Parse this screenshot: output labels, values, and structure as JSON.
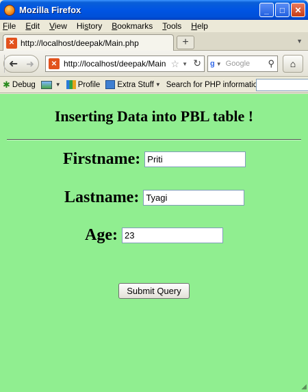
{
  "window": {
    "title": "Mozilla Firefox",
    "buttons": {
      "minimize": "_",
      "maximize": "□",
      "close": "✕"
    }
  },
  "menu": [
    {
      "label": "File",
      "accel": "F"
    },
    {
      "label": "Edit",
      "accel": "E"
    },
    {
      "label": "View",
      "accel": "V"
    },
    {
      "label": "History",
      "accel": "s"
    },
    {
      "label": "Bookmarks",
      "accel": "B"
    },
    {
      "label": "Tools",
      "accel": "T"
    },
    {
      "label": "Help",
      "accel": "H"
    }
  ],
  "tab": {
    "label": "http://localhost/deepak/Main.php",
    "new_tab": "+"
  },
  "nav": {
    "url": "http://localhost/deepak/Main.php",
    "url_visible": "http://localhost/deepak/Main",
    "search_placeholder": "Google"
  },
  "addon_bar": {
    "debug": "Debug",
    "profile": "Profile",
    "extra_stuff": "Extra Stuff",
    "php_search_label": "Search for PHP information:"
  },
  "page": {
    "heading": "Inserting Data into PBL table !",
    "fields": [
      {
        "label": "Firstname:",
        "value": "Priti"
      },
      {
        "label": "Lastname:",
        "value": "Tyagi"
      },
      {
        "label": "Age:",
        "value": "23"
      }
    ],
    "submit_label": "Submit Query",
    "background": "#90ee90"
  },
  "colors": {
    "titlebar": "#0054e3",
    "chrome": "#ece9d8"
  },
  "icons": {
    "app": "firefox-icon",
    "tab": "xampp-icon",
    "back": "back-arrow-icon",
    "forward": "forward-arrow-icon",
    "bookmark": "star-icon",
    "reload": "reload-icon",
    "search_engine": "google-icon",
    "search": "magnify-icon",
    "home": "home-icon"
  }
}
